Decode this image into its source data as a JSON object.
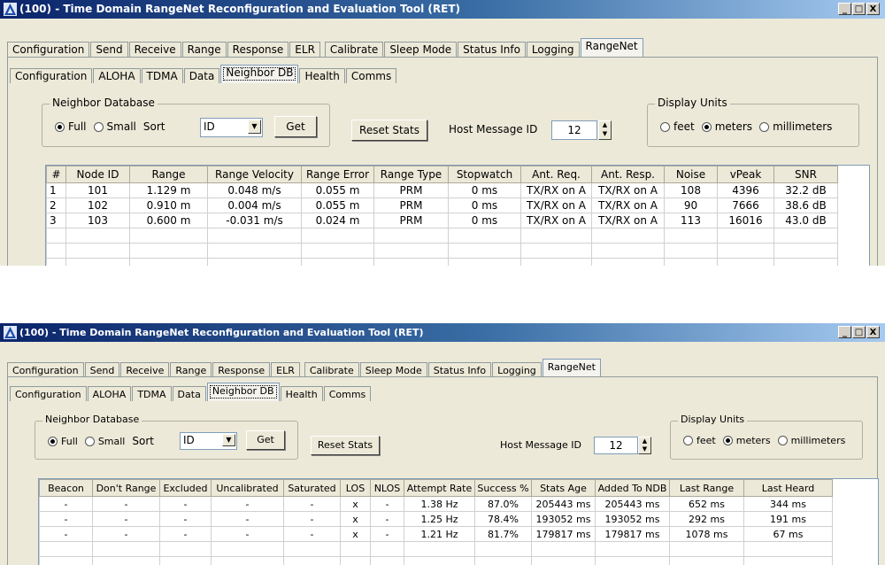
{
  "window": {
    "title": "(100) - Time Domain RangeNet Reconfiguration and Evaluation Tool (RET)",
    "minimize": "_",
    "maximize": "□",
    "close": "X"
  },
  "main_tabs": [
    {
      "label": "Configuration"
    },
    {
      "label": "Send"
    },
    {
      "label": "Receive"
    },
    {
      "label": "Range"
    },
    {
      "label": "Response"
    },
    {
      "label": "ELR"
    },
    {
      "label": "Calibrate"
    },
    {
      "label": "Sleep Mode"
    },
    {
      "label": "Status Info"
    },
    {
      "label": "Logging"
    },
    {
      "label": "RangeNet",
      "active": true
    }
  ],
  "sub_tabs": [
    {
      "label": "Configuration"
    },
    {
      "label": "ALOHA"
    },
    {
      "label": "TDMA"
    },
    {
      "label": "Data"
    },
    {
      "label": "Neighbor DB",
      "active": true
    },
    {
      "label": "Health"
    },
    {
      "label": "Comms"
    }
  ],
  "neighbor_db": {
    "group_label": "Neighbor Database",
    "full_label": "Full",
    "small_label": "Small",
    "sort_label": "Sort",
    "sort_value": "ID",
    "get_label": "Get"
  },
  "reset_stats_label": "Reset Stats",
  "host_message": {
    "label": "Host Message ID",
    "value": "12"
  },
  "display_units": {
    "group_label": "Display Units",
    "feet": "feet",
    "meters": "meters",
    "millimeters": "millimeters"
  },
  "table_top": {
    "columns": [
      "#",
      "Node ID",
      "Range",
      "Range Velocity",
      "Range Error",
      "Range Type",
      "Stopwatch",
      "Ant. Req.",
      "Ant. Resp.",
      "Noise",
      "vPeak",
      "SNR"
    ],
    "rows": [
      [
        "1",
        "101",
        "1.129 m",
        "0.048 m/s",
        "0.055 m",
        "PRM",
        "0 ms",
        "TX/RX on A",
        "TX/RX on A",
        "108",
        "4396",
        "32.2 dB"
      ],
      [
        "2",
        "102",
        "0.910 m",
        "0.004 m/s",
        "0.055 m",
        "PRM",
        "0 ms",
        "TX/RX on A",
        "TX/RX on A",
        "90",
        "7666",
        "38.6 dB"
      ],
      [
        "3",
        "103",
        "0.600 m",
        "-0.031 m/s",
        "0.024 m",
        "PRM",
        "0 ms",
        "TX/RX on A",
        "TX/RX on A",
        "113",
        "16016",
        "43.0 dB"
      ]
    ]
  },
  "table_bottom": {
    "columns": [
      "Beacon",
      "Don't Range",
      "Excluded",
      "Uncalibrated",
      "Saturated",
      "LOS",
      "NLOS",
      "Attempt Rate",
      "Success %",
      "Stats Age",
      "Added To NDB",
      "Last Range",
      "Last Heard"
    ],
    "rows": [
      [
        "-",
        "-",
        "-",
        "-",
        "-",
        "x",
        "-",
        "1.38 Hz",
        "87.0%",
        "205443 ms",
        "205443 ms",
        "652 ms",
        "344 ms"
      ],
      [
        "-",
        "-",
        "-",
        "-",
        "-",
        "x",
        "-",
        "1.25 Hz",
        "78.4%",
        "193052 ms",
        "193052 ms",
        "292 ms",
        "191 ms"
      ],
      [
        "-",
        "-",
        "-",
        "-",
        "-",
        "x",
        "-",
        "1.21 Hz",
        "81.7%",
        "179817 ms",
        "179817 ms",
        "1078 ms",
        "67 ms"
      ]
    ]
  }
}
